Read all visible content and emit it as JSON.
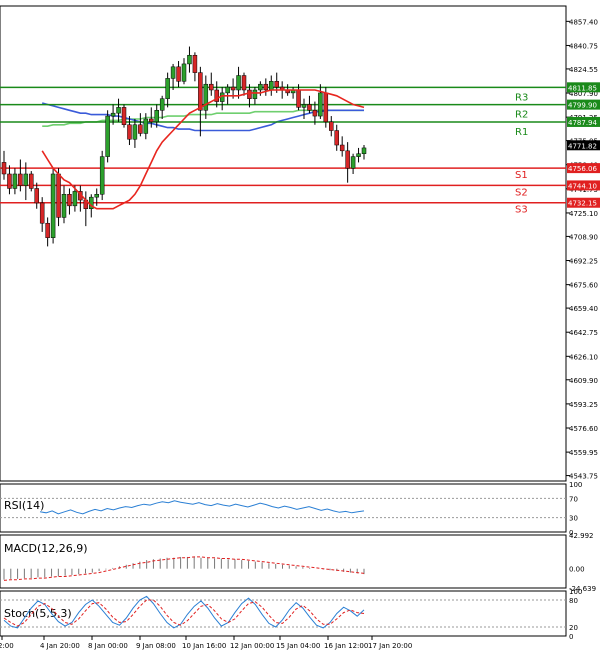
{
  "colors": {
    "background": "#ffffff",
    "bull": "#2ca02c",
    "bear": "#d62728",
    "ma_fast": "#e8261f",
    "ma_mid": "#3a5bd9",
    "ma_slow": "#6fcf6f",
    "resistance": "#1a8a1a",
    "support": "#e02020",
    "indicator": "#2a7fd4",
    "signal": "#e02020",
    "grid": "#000000"
  },
  "chart_data": [
    {
      "type": "candlestick",
      "title": "",
      "ylim": [
        4540,
        4868
      ],
      "y_ticks": [
        "4857.40",
        "4840.75",
        "4824.55",
        "4807.90",
        "4791.25",
        "4775.05",
        "4758.40",
        "4741.75",
        "4725.10",
        "4708.90",
        "4692.25",
        "4675.60",
        "4659.40",
        "4642.75",
        "4626.10",
        "4609.90",
        "4593.25",
        "4576.60",
        "4559.95",
        "4543.75"
      ],
      "x_labels": [
        "2:00",
        "4 Jan 20:00",
        "8 Jan 00:00",
        "9 Jan 08:00",
        "10 Jan 16:00",
        "12 Jan 00:00",
        "15 Jan 04:00",
        "16 Jan 12:00",
        "17 Jan 20:00"
      ],
      "current_price": "4771.82",
      "levels": [
        {
          "name": "R3",
          "price": 4811.85,
          "label": "4811.85",
          "kind": "resistance"
        },
        {
          "name": "R2",
          "price": 4799.9,
          "label": "4799.90",
          "kind": "resistance"
        },
        {
          "name": "R1",
          "price": 4787.94,
          "label": "4787.94",
          "kind": "resistance"
        },
        {
          "name": "S1",
          "price": 4756.06,
          "label": "4756.06",
          "kind": "support"
        },
        {
          "name": "S2",
          "price": 4744.1,
          "label": "4744.10",
          "kind": "support"
        },
        {
          "name": "S3",
          "price": 4732.15,
          "label": "4732.15",
          "kind": "support"
        }
      ],
      "ohlc": [
        [
          4760,
          4768,
          4748,
          4752
        ],
        [
          4752,
          4758,
          4738,
          4742
        ],
        [
          4742,
          4756,
          4738,
          4752
        ],
        [
          4752,
          4762,
          4740,
          4744
        ],
        [
          4744,
          4760,
          4734,
          4752
        ],
        [
          4752,
          4754,
          4740,
          4742
        ],
        [
          4742,
          4746,
          4728,
          4732
        ],
        [
          4732,
          4736,
          4712,
          4718
        ],
        [
          4718,
          4722,
          4702,
          4708
        ],
        [
          4708,
          4756,
          4704,
          4752
        ],
        [
          4752,
          4756,
          4716,
          4722
        ],
        [
          4722,
          4744,
          4718,
          4738
        ],
        [
          4738,
          4742,
          4724,
          4730
        ],
        [
          4730,
          4744,
          4726,
          4740
        ],
        [
          4740,
          4744,
          4726,
          4734
        ],
        [
          4734,
          4740,
          4716,
          4728
        ],
        [
          4728,
          4738,
          4722,
          4736
        ],
        [
          4736,
          4742,
          4730,
          4738
        ],
        [
          4738,
          4768,
          4734,
          4764
        ],
        [
          4764,
          4796,
          4760,
          4792
        ],
        [
          4792,
          4800,
          4786,
          4794
        ],
        [
          4794,
          4804,
          4788,
          4798
        ],
        [
          4798,
          4800,
          4784,
          4786
        ],
        [
          4786,
          4792,
          4772,
          4776
        ],
        [
          4776,
          4790,
          4770,
          4786
        ],
        [
          4786,
          4794,
          4778,
          4780
        ],
        [
          4780,
          4794,
          4776,
          4790
        ],
        [
          4790,
          4798,
          4784,
          4788
        ],
        [
          4788,
          4800,
          4784,
          4796
        ],
        [
          4796,
          4806,
          4790,
          4804
        ],
        [
          4804,
          4822,
          4798,
          4818
        ],
        [
          4818,
          4828,
          4810,
          4826
        ],
        [
          4826,
          4830,
          4812,
          4816
        ],
        [
          4816,
          4832,
          4814,
          4828
        ],
        [
          4828,
          4840,
          4822,
          4834
        ],
        [
          4834,
          4836,
          4816,
          4822
        ],
        [
          4822,
          4826,
          4778,
          4796
        ],
        [
          4796,
          4820,
          4790,
          4814
        ],
        [
          4814,
          4822,
          4806,
          4810
        ],
        [
          4810,
          4816,
          4798,
          4802
        ],
        [
          4802,
          4812,
          4796,
          4808
        ],
        [
          4808,
          4814,
          4800,
          4812
        ],
        [
          4812,
          4818,
          4804,
          4810
        ],
        [
          4810,
          4826,
          4804,
          4820
        ],
        [
          4820,
          4822,
          4806,
          4810
        ],
        [
          4810,
          4814,
          4798,
          4804
        ],
        [
          4804,
          4812,
          4800,
          4810
        ],
        [
          4810,
          4816,
          4806,
          4814
        ],
        [
          4814,
          4818,
          4806,
          4810
        ],
        [
          4810,
          4820,
          4806,
          4816
        ],
        [
          4816,
          4822,
          4808,
          4812
        ],
        [
          4812,
          4816,
          4804,
          4810
        ],
        [
          4810,
          4814,
          4806,
          4808
        ],
        [
          4808,
          4812,
          4804,
          4810
        ],
        [
          4810,
          4814,
          4796,
          4798
        ],
        [
          4798,
          4804,
          4790,
          4800
        ],
        [
          4800,
          4806,
          4794,
          4796
        ],
        [
          4796,
          4802,
          4786,
          4792
        ],
        [
          4792,
          4814,
          4790,
          4808
        ],
        [
          4808,
          4812,
          4784,
          4788
        ],
        [
          4788,
          4792,
          4778,
          4782
        ],
        [
          4782,
          4786,
          4768,
          4772
        ],
        [
          4772,
          4778,
          4764,
          4768
        ],
        [
          4768,
          4774,
          4746,
          4756
        ],
        [
          4756,
          4766,
          4752,
          4764
        ],
        [
          4764,
          4770,
          4760,
          4766
        ],
        [
          4766,
          4772,
          4762,
          4770
        ]
      ],
      "ma_fast": [
        4768,
        4762,
        4756,
        4752,
        4748,
        4746,
        4742,
        4738,
        4734,
        4730,
        4728,
        4728,
        4728,
        4728,
        4730,
        4732,
        4734,
        4738,
        4744,
        4752,
        4760,
        4768,
        4774,
        4778,
        4782,
        4786,
        4790,
        4794,
        4796,
        4798,
        4800,
        4802,
        4804,
        4806,
        4806,
        4806,
        4806,
        4807,
        4808,
        4808,
        4808,
        4809,
        4810,
        4810,
        4810,
        4810,
        4810,
        4810,
        4810,
        4810,
        4810,
        4809,
        4808,
        4807,
        4806,
        4804,
        4802,
        4800,
        4799,
        4798
      ],
      "ma_mid": [
        4801,
        4800,
        4799,
        4798,
        4797,
        4796,
        4795,
        4794,
        4794,
        4793,
        4793,
        4793,
        4793,
        4792,
        4792,
        4791,
        4790,
        4789,
        4788,
        4787,
        4787,
        4786,
        4785,
        4784,
        4784,
        4783,
        4783,
        4783,
        4782,
        4782,
        4782,
        4782,
        4782,
        4782,
        4782,
        4782,
        4782,
        4782,
        4782,
        4783,
        4784,
        4785,
        4786,
        4788,
        4789,
        4790,
        4791,
        4792,
        4793,
        4794,
        4795,
        4795,
        4796,
        4796,
        4796,
        4796,
        4796,
        4796,
        4796,
        4796
      ],
      "ma_slow": [
        4785,
        4785,
        4786,
        4786,
        4786,
        4787,
        4787,
        4787,
        4788,
        4788,
        4788,
        4789,
        4789,
        4789,
        4789,
        4790,
        4790,
        4790,
        4790,
        4791,
        4791,
        4791,
        4791,
        4792,
        4792,
        4792,
        4792,
        4793,
        4793,
        4793,
        4793,
        4793,
        4794,
        4794,
        4794,
        4794,
        4794,
        4794,
        4794,
        4795,
        4795,
        4795,
        4795,
        4795,
        4795,
        4795,
        4795,
        4796,
        4796,
        4796,
        4796,
        4796,
        4796,
        4796,
        4796,
        4796,
        4796,
        4796,
        4796,
        4796
      ]
    },
    {
      "type": "line",
      "name": "RSI(14)",
      "ylim": [
        0,
        100
      ],
      "y_ticks": [
        "100",
        "70",
        "30",
        "0"
      ],
      "values": [
        42,
        40,
        44,
        38,
        42,
        46,
        41,
        38,
        43,
        47,
        44,
        49,
        46,
        50,
        53,
        51,
        55,
        58,
        56,
        60,
        63,
        61,
        65,
        62,
        60,
        58,
        61,
        57,
        55,
        59,
        56,
        54,
        58,
        55,
        52,
        56,
        60,
        57,
        53,
        50,
        54,
        51,
        47,
        50,
        53,
        49,
        45,
        48,
        44,
        41,
        43,
        40,
        42,
        44
      ]
    },
    {
      "type": "bar",
      "name": "MACD(12,26,9)",
      "ylim": [
        -24.639,
        42.992
      ],
      "y_ticks": [
        "42.992",
        "0.00",
        "-24.639"
      ],
      "values": [
        -14,
        -13,
        -13,
        -12,
        -12,
        -11,
        -11,
        -10,
        -10,
        -9,
        -8,
        -7,
        -6,
        -5,
        -3,
        -1,
        1,
        3,
        5,
        7,
        9,
        11,
        12,
        13,
        14,
        14,
        15,
        15,
        15,
        14,
        14,
        13,
        13,
        12,
        12,
        11,
        10,
        9,
        8,
        7,
        6,
        5,
        4,
        3,
        2,
        1,
        0,
        -1,
        -2,
        -3,
        -4,
        -5,
        -6,
        -7
      ],
      "signal": [
        -15,
        -14,
        -14,
        -13,
        -13,
        -12,
        -12,
        -11,
        -10,
        -10,
        -9,
        -8,
        -7,
        -6,
        -5,
        -3,
        -1,
        1,
        3,
        5,
        7,
        8,
        10,
        11,
        12,
        13,
        14,
        14,
        15,
        15,
        14,
        14,
        13,
        13,
        12,
        12,
        11,
        10,
        9,
        8,
        7,
        6,
        5,
        4,
        3,
        2,
        1,
        0,
        -1,
        -2,
        -3,
        -4,
        -5,
        -6
      ]
    },
    {
      "type": "line",
      "name": "Stoch(5,5,3)",
      "ylim": [
        0,
        100
      ],
      "y_ticks": [
        "100",
        "80",
        "20",
        "0"
      ],
      "main": [
        35,
        22,
        18,
        40,
        62,
        78,
        70,
        50,
        32,
        22,
        30,
        52,
        70,
        80,
        66,
        48,
        30,
        24,
        40,
        62,
        80,
        88,
        72,
        50,
        30,
        18,
        26,
        48,
        66,
        78,
        62,
        40,
        22,
        30,
        52,
        72,
        84,
        70,
        48,
        28,
        20,
        36,
        58,
        74,
        62,
        42,
        24,
        18,
        30,
        50,
        64,
        56,
        44,
        58
      ],
      "signal": [
        40,
        30,
        22,
        30,
        48,
        66,
        72,
        62,
        44,
        30,
        26,
        38,
        56,
        72,
        74,
        60,
        42,
        30,
        32,
        48,
        66,
        80,
        80,
        66,
        46,
        30,
        24,
        34,
        50,
        66,
        70,
        56,
        38,
        30,
        38,
        56,
        72,
        76,
        64,
        46,
        30,
        28,
        42,
        60,
        68,
        56,
        38,
        26,
        26,
        38,
        52,
        58,
        52,
        50
      ]
    }
  ]
}
